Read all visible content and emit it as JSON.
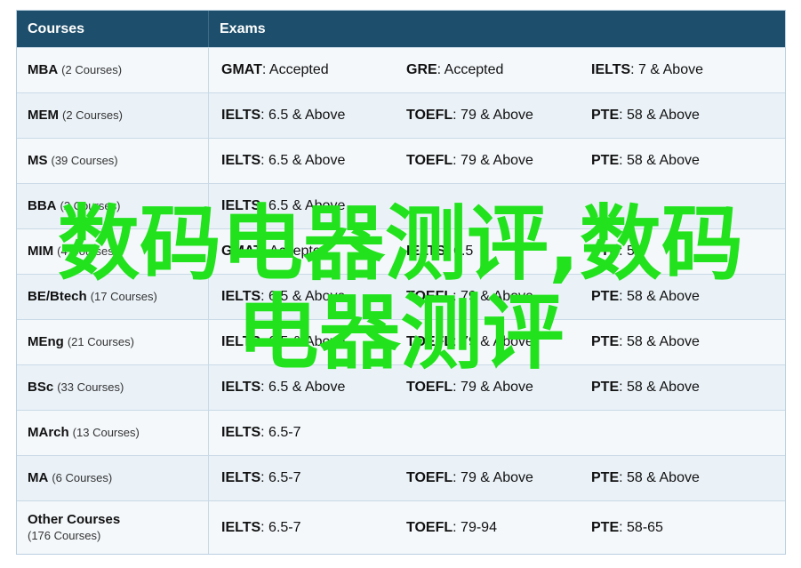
{
  "header": {
    "courses": "Courses",
    "exams": "Exams"
  },
  "rows": [
    {
      "name": "MBA",
      "count": "(2 Courses)",
      "exams": [
        [
          "GMAT",
          ": Accepted"
        ],
        [
          "GRE",
          ": Accepted"
        ],
        [
          "IELTS",
          ": 7 & Above"
        ]
      ]
    },
    {
      "name": "MEM",
      "count": "(2 Courses)",
      "exams": [
        [
          "IELTS",
          ": 6.5 & Above"
        ],
        [
          "TOEFL",
          ": 79 & Above"
        ],
        [
          "PTE",
          ": 58 & Above"
        ]
      ]
    },
    {
      "name": "MS",
      "count": "(39 Courses)",
      "exams": [
        [
          "IELTS",
          ": 6.5 & Above"
        ],
        [
          "TOEFL",
          ": 79 & Above"
        ],
        [
          "PTE",
          ": 58 & Above"
        ]
      ]
    },
    {
      "name": "BBA",
      "count": "(2 Courses)",
      "exams": [
        [
          "IELTS",
          ": 6.5 & Above"
        ]
      ]
    },
    {
      "name": "MIM",
      "count": "(4 Courses)",
      "exams": [
        [
          "GMAT",
          ": Accepted"
        ],
        [
          "IELTS",
          ": 6.5"
        ],
        [
          "PTE",
          ": 58"
        ]
      ]
    },
    {
      "name": "BE/Btech",
      "count": "(17 Courses)",
      "exams": [
        [
          "IELTS",
          ": 6.5 & Above"
        ],
        [
          "TOEFL",
          ": 79 & Above"
        ],
        [
          "PTE",
          ": 58 & Above"
        ]
      ]
    },
    {
      "name": "MEng",
      "count": "(21 Courses)",
      "exams": [
        [
          "IELTS",
          ": 6.5 & Above"
        ],
        [
          "TOEFL",
          ": 79 & Above"
        ],
        [
          "PTE",
          ": 58 & Above"
        ]
      ]
    },
    {
      "name": "BSc",
      "count": "(33 Courses)",
      "exams": [
        [
          "IELTS",
          ": 6.5 & Above"
        ],
        [
          "TOEFL",
          ": 79 & Above"
        ],
        [
          "PTE",
          ": 58 & Above"
        ]
      ]
    },
    {
      "name": "MArch",
      "count": "(13 Courses)",
      "exams": [
        [
          "IELTS",
          ": 6.5-7"
        ]
      ]
    },
    {
      "name": "MA",
      "count": "(6 Courses)",
      "exams": [
        [
          "IELTS",
          ": 6.5-7"
        ],
        [
          "TOEFL",
          ": 79 & Above"
        ],
        [
          "PTE",
          ": 58 & Above"
        ]
      ]
    },
    {
      "name": "Other Courses",
      "count": "(176 Courses)",
      "two_line": true,
      "exams": [
        [
          "IELTS",
          ": 6.5-7"
        ],
        [
          "TOEFL",
          ": 79-94"
        ],
        [
          "PTE",
          ": 58-65"
        ]
      ]
    }
  ],
  "watermark": {
    "line1": "数码电器测评,数码",
    "line2": "电器测评"
  },
  "colors": {
    "header_bg": "#1d4e6b",
    "watermark": "#22e21d"
  }
}
